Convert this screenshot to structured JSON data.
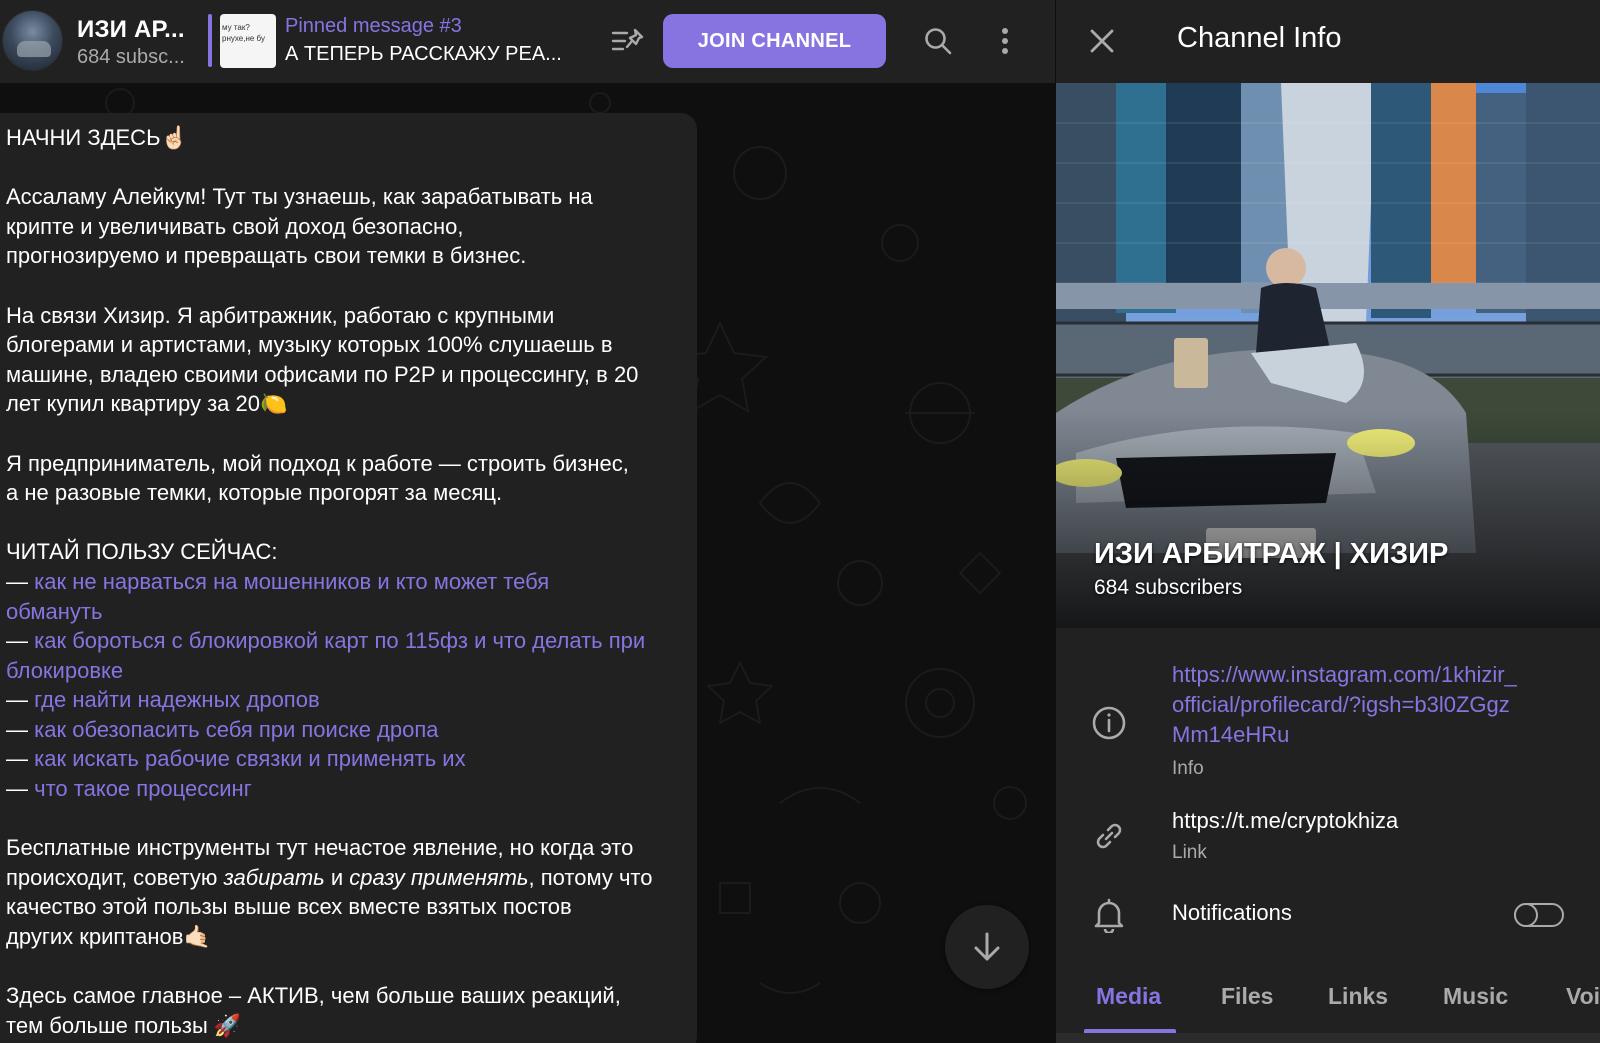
{
  "header": {
    "channel_name": "ИЗИ АР...",
    "subscribers": "684 subsc...",
    "pinned_title": "Pinned message #3",
    "pinned_text": "А ТЕПЕРЬ РАССКАЖУ РЕА...",
    "pinned_thumb_lines": [
      "му так?",
      "рнухе,не бу"
    ],
    "join_label": "JOIN CHANNEL",
    "icons": [
      "pinned-list-icon",
      "search-icon",
      "more-vertical-icon"
    ]
  },
  "message": {
    "title": "НАЧНИ ЗДЕСЬ☝🏻",
    "p1": [
      "Ассаламу Алейкум! Тут ты узнаешь, как зарабатывать на",
      "крипте и увеличивать свой доход безопасно,",
      "прогнозируемо и превращать свои темки в бизнес."
    ],
    "p2": [
      "На связи Хизир. Я арбитражник, работаю с крупными",
      "блогерами и артистами, музыку которых 100% слушаешь в",
      "машине, владею своими офисами по P2P и процессингу, в 20",
      "лет купил квартиру за 20🍋"
    ],
    "p3": [
      "Я предприниматель, мой подход к работе — строить бизнес,",
      "а не разовые темки, которые прогорят за месяц."
    ],
    "list_heading": "ЧИТАЙ ПОЛЬЗУ СЕЙЧАС:",
    "dash": "— ",
    "links": [
      [
        "как не нарваться на мошенников и кто может тебя",
        "обмануть"
      ],
      [
        "как бороться с блокировкой карт по 115фз и что делать при",
        "блокировке"
      ],
      [
        "где найти надежных дропов"
      ],
      [
        "как обезопасить себя при поиске дропа"
      ],
      [
        "как искать рабочие связки и применять их"
      ],
      [
        "что такое процессинг"
      ]
    ],
    "p4_line1": "Бесплатные инструменты тут нечастое явление, но когда это",
    "p4_line2_a": "происходит, советую ",
    "p4_line2_em1": "забирать",
    "p4_line2_b": " и ",
    "p4_line2_em2": "сразу применять",
    "p4_line2_c": ", потому что",
    "p4_line3": "качество этой пользы выше всех вместе взятых постов",
    "p4_line4": "других криптанов🤙🏻",
    "p5": [
      "Здесь самое главное – АКТИВ, чем больше ваших реакций,",
      "тем больше пользы 🚀"
    ]
  },
  "info": {
    "title": "Channel Info",
    "channel_name": "ИЗИ АРБИТРАЖ | ХИЗИР",
    "subscribers": "684 subscribers",
    "bio_lines": [
      "https://www.instagram.com/1khizir_",
      "official/profilecard/?igsh=b3l0ZGgz",
      "Mm14eHRu"
    ],
    "bio_label": "Info",
    "link": "https://t.me/cryptokhiza",
    "link_label": "Link",
    "notifications_label": "Notifications",
    "notifications_on": false,
    "tabs": [
      "Media",
      "Files",
      "Links",
      "Music",
      "Voi"
    ],
    "active_tab": "Media"
  },
  "colors": {
    "accent": "#8774e1",
    "panel": "#212121",
    "background": "#0f0f0f",
    "secondary_text": "#aaaaaa"
  }
}
